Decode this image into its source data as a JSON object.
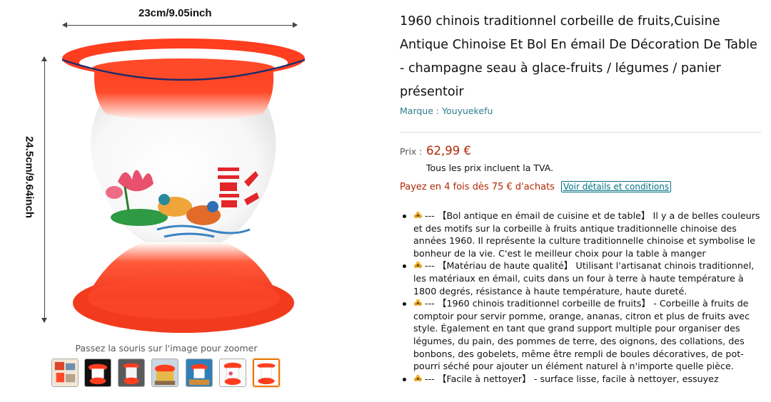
{
  "gallery": {
    "dimension_width_label": "23cm/9.05inch",
    "dimension_height_label": "24.5cm/9.64inch",
    "zoom_hint": "Passez la souris sur l'image pour zoomer",
    "thumbnails": [
      {
        "name": "thumbnail-1",
        "selected": false
      },
      {
        "name": "thumbnail-2",
        "selected": false
      },
      {
        "name": "thumbnail-3",
        "selected": false
      },
      {
        "name": "thumbnail-4",
        "selected": false
      },
      {
        "name": "thumbnail-5",
        "selected": false
      },
      {
        "name": "thumbnail-6",
        "selected": false
      },
      {
        "name": "thumbnail-7",
        "selected": true
      }
    ]
  },
  "product": {
    "title": "1960 chinois traditionnel corbeille de fruits,Cuisine Antique Chinoise Et Bol En émail De Décoration De Table - champagne seau à glace-fruits / légumes / panier présentoir",
    "brand": "Marque : Youyuekefu",
    "price_label": "Prix :",
    "price": "62,99 €",
    "tax_note": "Tous les prix incluent la TVA.",
    "installments": "Payez en 4 fois dès 75 € d'achats",
    "installments_link": "Voir détails et conditions"
  },
  "bullets": [
    {
      "icon": "bullet-flower-icon",
      "text": "--- 【Bol antique en émail de cuisine et de table】 Il y a de belles couleurs et des motifs sur la corbeille à fruits antique traditionnelle chinoise des années 1960. Il représente la culture traditionnelle chinoise et symbolise le bonheur de la vie. C'est le meilleur choix pour la table à manger"
    },
    {
      "icon": "bullet-flower-icon",
      "text": "--- 【Matériau de haute qualité】 Utilisant l'artisanat chinois traditionnel, les matériaux en émail, cuits dans un four à terre à haute température à 1800 degrés, résistance à haute température, haute dureté."
    },
    {
      "icon": "bullet-flower-icon",
      "text": "--- 【1960 chinois traditionnel corbeille de fruits】 - Corbeille à fruits de comptoir pour servir pomme, orange, ananas, citron et plus de fruits avec style. Également en tant que grand support multiple pour organiser des légumes, du pain, des pommes de terre, des oignons, des collations, des bonbons, des gobelets, même être rempli de boules décoratives, de pot-pourri séché pour ajouter un élément naturel à n'importe quelle pièce."
    },
    {
      "icon": "bullet-flower-icon",
      "text": "--- 【Facile à nettoyer】 - surface lisse, facile à nettoyer, essuyez"
    }
  ],
  "colors": {
    "price": "#b12704",
    "link": "#007185",
    "brand_link": "#2e7d8c",
    "selected_thumb": "#e77600",
    "vase_red": "#ff3d1f"
  }
}
